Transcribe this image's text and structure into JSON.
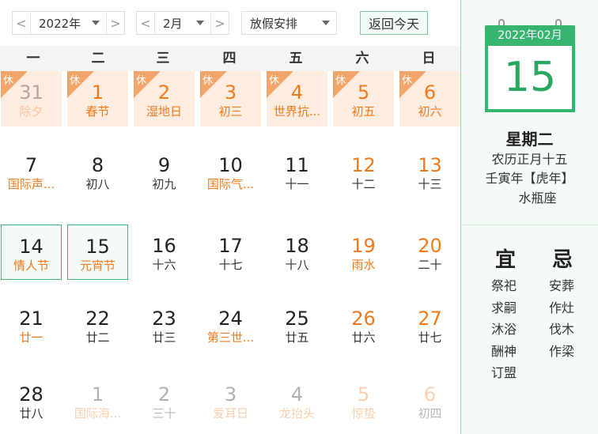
{
  "toolbar": {
    "year_prev": "<",
    "year_value": "2022年",
    "year_next": ">",
    "month_prev": "<",
    "month_value": "2月",
    "month_next": ">",
    "holiday_select": "放假安排",
    "today_button": "返回今天"
  },
  "weekdays": [
    "一",
    "二",
    "三",
    "四",
    "五",
    "六",
    "日"
  ],
  "rest_tag": "休",
  "grid": [
    [
      {
        "day": "31",
        "lunar": "除夕",
        "rest": true,
        "other": true,
        "weekend": false,
        "festival": true
      },
      {
        "day": "1",
        "lunar": "春节",
        "rest": true,
        "other": false,
        "weekend": false,
        "festival": true
      },
      {
        "day": "2",
        "lunar": "湿地日",
        "rest": true,
        "other": false,
        "weekend": false,
        "festival": true
      },
      {
        "day": "3",
        "lunar": "初三",
        "rest": true,
        "other": false,
        "weekend": false,
        "festival": false
      },
      {
        "day": "4",
        "lunar": "世界抗...",
        "rest": true,
        "other": false,
        "weekend": false,
        "festival": true
      },
      {
        "day": "5",
        "lunar": "初五",
        "rest": true,
        "other": false,
        "weekend": true,
        "festival": false
      },
      {
        "day": "6",
        "lunar": "初六",
        "rest": true,
        "other": false,
        "weekend": true,
        "festival": false
      }
    ],
    [
      {
        "day": "7",
        "lunar": "国际声...",
        "rest": false,
        "other": false,
        "weekend": false,
        "festival": true
      },
      {
        "day": "8",
        "lunar": "初八",
        "rest": false,
        "other": false,
        "weekend": false,
        "festival": false
      },
      {
        "day": "9",
        "lunar": "初九",
        "rest": false,
        "other": false,
        "weekend": false,
        "festival": false
      },
      {
        "day": "10",
        "lunar": "国际气...",
        "rest": false,
        "other": false,
        "weekend": false,
        "festival": true
      },
      {
        "day": "11",
        "lunar": "十一",
        "rest": false,
        "other": false,
        "weekend": false,
        "festival": false
      },
      {
        "day": "12",
        "lunar": "十二",
        "rest": false,
        "other": false,
        "weekend": true,
        "festival": false
      },
      {
        "day": "13",
        "lunar": "十三",
        "rest": false,
        "other": false,
        "weekend": true,
        "festival": false
      }
    ],
    [
      {
        "day": "14",
        "lunar": "情人节",
        "rest": false,
        "other": false,
        "weekend": false,
        "festival": true,
        "boxed": true
      },
      {
        "day": "15",
        "lunar": "元宵节",
        "rest": false,
        "other": false,
        "weekend": false,
        "festival": true,
        "boxed": true
      },
      {
        "day": "16",
        "lunar": "十六",
        "rest": false,
        "other": false,
        "weekend": false,
        "festival": false
      },
      {
        "day": "17",
        "lunar": "十七",
        "rest": false,
        "other": false,
        "weekend": false,
        "festival": false
      },
      {
        "day": "18",
        "lunar": "十八",
        "rest": false,
        "other": false,
        "weekend": false,
        "festival": false
      },
      {
        "day": "19",
        "lunar": "雨水",
        "rest": false,
        "other": false,
        "weekend": true,
        "festival": true
      },
      {
        "day": "20",
        "lunar": "二十",
        "rest": false,
        "other": false,
        "weekend": true,
        "festival": false
      }
    ],
    [
      {
        "day": "21",
        "lunar": "廿一",
        "rest": false,
        "other": false,
        "weekend": false,
        "festival": true
      },
      {
        "day": "22",
        "lunar": "廿二",
        "rest": false,
        "other": false,
        "weekend": false,
        "festival": false
      },
      {
        "day": "23",
        "lunar": "廿三",
        "rest": false,
        "other": false,
        "weekend": false,
        "festival": false
      },
      {
        "day": "24",
        "lunar": "第三世...",
        "rest": false,
        "other": false,
        "weekend": false,
        "festival": true
      },
      {
        "day": "25",
        "lunar": "廿五",
        "rest": false,
        "other": false,
        "weekend": false,
        "festival": false
      },
      {
        "day": "26",
        "lunar": "廿六",
        "rest": false,
        "other": false,
        "weekend": true,
        "festival": false
      },
      {
        "day": "27",
        "lunar": "廿七",
        "rest": false,
        "other": false,
        "weekend": true,
        "festival": false
      }
    ],
    [
      {
        "day": "28",
        "lunar": "廿八",
        "rest": false,
        "other": false,
        "weekend": false,
        "festival": false
      },
      {
        "day": "1",
        "lunar": "国际海...",
        "rest": false,
        "other": true,
        "weekend": false,
        "festival": true
      },
      {
        "day": "2",
        "lunar": "三十",
        "rest": false,
        "other": true,
        "weekend": false,
        "festival": false
      },
      {
        "day": "3",
        "lunar": "爱耳日",
        "rest": false,
        "other": true,
        "weekend": false,
        "festival": true
      },
      {
        "day": "4",
        "lunar": "龙抬头",
        "rest": false,
        "other": true,
        "weekend": false,
        "festival": true
      },
      {
        "day": "5",
        "lunar": "惊蛰",
        "rest": false,
        "other": true,
        "weekend": true,
        "festival": true
      },
      {
        "day": "6",
        "lunar": "初四",
        "rest": false,
        "other": true,
        "weekend": true,
        "festival": false
      }
    ]
  ],
  "side": {
    "pad_header": "2022年02月",
    "pad_day": "15",
    "weekday": "星期二",
    "lunar_date": "农历正月十五",
    "ganzhi": "壬寅年【虎年】",
    "zodiac_sign": "水瓶座",
    "yi_title": "宜",
    "ji_title": "忌",
    "yi_items": [
      "祭祀",
      "求嗣",
      "沐浴",
      "酬神",
      "订盟"
    ],
    "ji_items": [
      "安葬",
      "作灶",
      "伐木",
      "作梁"
    ]
  },
  "colors": {
    "accent_green": "#36b56f",
    "holiday_orange": "#f07a1a",
    "rest_bg": "#fdece0"
  }
}
